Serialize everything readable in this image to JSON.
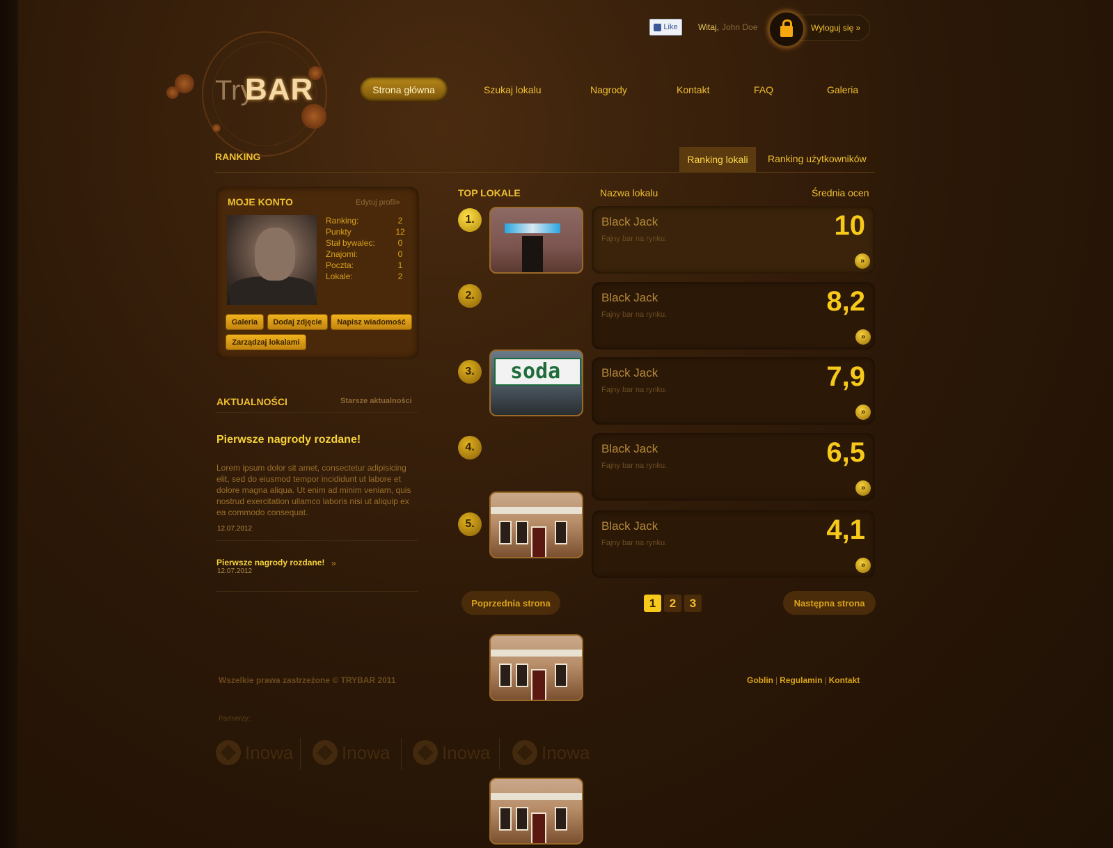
{
  "header": {
    "like_label": "Like",
    "welcome_label": "Witaj,",
    "user_name": "John Doe",
    "logout_label": "Wyloguj się »"
  },
  "logo": {
    "part1": "Try",
    "part2": "BAR"
  },
  "nav": {
    "items": [
      "Strona główna",
      "Szukaj lokalu",
      "Nagrody",
      "Kontakt",
      "FAQ",
      "Galeria"
    ],
    "active_index": 0
  },
  "ranking": {
    "section_title": "RANKING",
    "tabs": [
      "Ranking lokali",
      "Ranking użytkowników"
    ],
    "active_tab": 0
  },
  "account": {
    "title": "MOJE KONTO",
    "edit_profile": "Edytuj profil»",
    "stats": [
      {
        "label": "Ranking:",
        "value": "2"
      },
      {
        "label": "Punkty",
        "value": "12"
      },
      {
        "label": "Stał bywalec:",
        "value": "0"
      },
      {
        "label": "Znajomi:",
        "value": "0"
      },
      {
        "label": "Poczta:",
        "value": "1"
      },
      {
        "label": "Lokale:",
        "value": "2"
      }
    ],
    "buttons": [
      "Galeria",
      "Dodaj zdjęcie",
      "Napisz wiadomość",
      "Zarządzaj lokalami"
    ]
  },
  "news": {
    "title": "AKTUALNOŚCI",
    "older_link": "Starsze aktualności",
    "headline": "Pierwsze nagrody rozdane!",
    "body": "Lorem ipsum dolor sit amet, consectetur adipisicing elit, sed do eiusmod tempor incididunt ut labore et dolore magna aliqua. Ut enim ad minim veniam, quis nostrud exercitation ullamco laboris nisi ut aliquip ex ea commodo consequat.",
    "date": "12.07.2012",
    "link_title": "Pierwsze nagrody rozdane!",
    "link_arrow": "»",
    "link_date": "12.07.2012"
  },
  "top": {
    "title": "TOP LOKALE",
    "col_name": "Nazwa lokalu",
    "col_score": "Średnia ocen",
    "venues": [
      {
        "rank": "1.",
        "name": "Black Jack",
        "desc": "Fajny bar na rynku.",
        "score": "10",
        "arrow": "»"
      },
      {
        "rank": "2.",
        "name": "Black Jack",
        "desc": "Fajny bar na rynku.",
        "score": "8,2",
        "arrow": "»"
      },
      {
        "rank": "3.",
        "name": "Black Jack",
        "desc": "Fajny bar na rynku.",
        "score": "7,9",
        "arrow": "»"
      },
      {
        "rank": "4.",
        "name": "Black Jack",
        "desc": "Fajny bar na rynku.",
        "score": "6,5",
        "arrow": "»"
      },
      {
        "rank": "5.",
        "name": "Black Jack",
        "desc": "Fajny bar na rynku.",
        "score": "4,1",
        "arrow": "»"
      }
    ],
    "soda_sign": "soda"
  },
  "pagination": {
    "prev": "Poprzednia strona",
    "next": "Następna strona",
    "pages": [
      "1",
      "2",
      "3"
    ],
    "current": "1"
  },
  "footer": {
    "copyright": "Wszelkie prawa zastrzeżone © TRYBAR 2011",
    "links": [
      "Goblin",
      "Regulamin",
      "Kontakt"
    ],
    "link_separator": "|",
    "partners_label": "Partnerzy:",
    "partners": [
      "Inowa",
      "Inowa",
      "Inowa",
      "Inowa"
    ]
  },
  "colors": {
    "accent": "#f0c030",
    "score": "#f7c91a",
    "background": "#2a1707"
  }
}
